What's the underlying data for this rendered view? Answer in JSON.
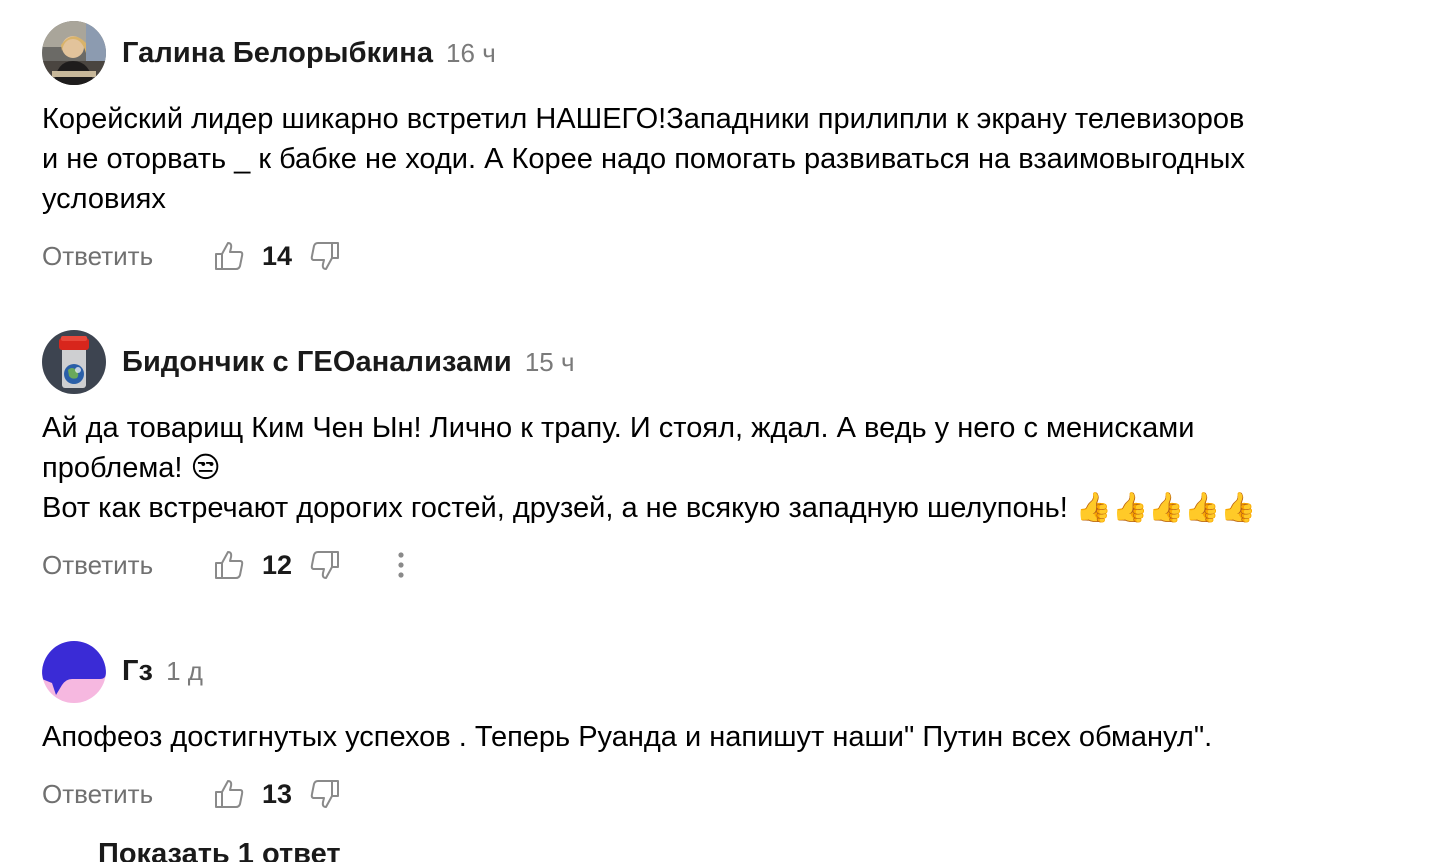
{
  "comments": [
    {
      "author": "Галина Белорыбкина",
      "time": "16 ч",
      "text": "Корейский лидер шикарно встретил НАШЕГО!Западники прилипли к экрану телевизоров\nи не оторвать _ к бабке не ходи. А Корее надо помогать развиваться на взаимовыгодных\nусловиях",
      "reply_label": "Ответить",
      "likes": "14",
      "avatar": "photo-woman"
    },
    {
      "author": "Бидончик с ГЕОанализами",
      "time": "15 ч",
      "text": "Ай да товарищ Ким Чен Ын! Лично к трапу. И стоял, ждал. А ведь у него с менисками\nпроблема! 😒\nВот как встречают дорогих гостей, друзей, а не всякую западную шелупонь! 👍👍👍👍👍",
      "reply_label": "Ответить",
      "likes": "12",
      "avatar": "jar-earth"
    },
    {
      "author": "Гз",
      "time": "1 д",
      "text": "Апофеоз достигнутых успехов . Теперь Руанда и напишут наши\" Путин всех обманул\".",
      "reply_label": "Ответить",
      "likes": "13",
      "avatar": "purple-pink-logo"
    }
  ],
  "show_replies": "Показать 1 ответ",
  "icons": {
    "like": "thumb-up-icon",
    "dislike": "thumb-down-icon",
    "more": "more-vertical-icon"
  },
  "colors": {
    "secondary_text": "#707070",
    "time_text": "#7a7a7a",
    "icon": "#8a8a8a"
  }
}
